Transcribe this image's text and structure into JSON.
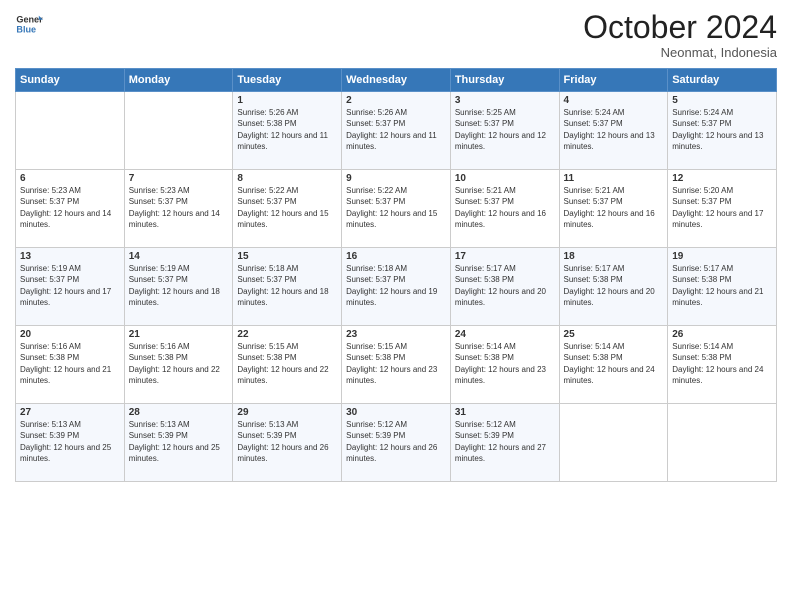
{
  "header": {
    "logo_line1": "General",
    "logo_line2": "Blue",
    "month": "October 2024",
    "location": "Neonmat, Indonesia"
  },
  "days_of_week": [
    "Sunday",
    "Monday",
    "Tuesday",
    "Wednesday",
    "Thursday",
    "Friday",
    "Saturday"
  ],
  "weeks": [
    [
      {
        "day": "",
        "sunrise": "",
        "sunset": "",
        "daylight": ""
      },
      {
        "day": "",
        "sunrise": "",
        "sunset": "",
        "daylight": ""
      },
      {
        "day": "1",
        "sunrise": "Sunrise: 5:26 AM",
        "sunset": "Sunset: 5:38 PM",
        "daylight": "Daylight: 12 hours and 11 minutes."
      },
      {
        "day": "2",
        "sunrise": "Sunrise: 5:26 AM",
        "sunset": "Sunset: 5:37 PM",
        "daylight": "Daylight: 12 hours and 11 minutes."
      },
      {
        "day": "3",
        "sunrise": "Sunrise: 5:25 AM",
        "sunset": "Sunset: 5:37 PM",
        "daylight": "Daylight: 12 hours and 12 minutes."
      },
      {
        "day": "4",
        "sunrise": "Sunrise: 5:24 AM",
        "sunset": "Sunset: 5:37 PM",
        "daylight": "Daylight: 12 hours and 13 minutes."
      },
      {
        "day": "5",
        "sunrise": "Sunrise: 5:24 AM",
        "sunset": "Sunset: 5:37 PM",
        "daylight": "Daylight: 12 hours and 13 minutes."
      }
    ],
    [
      {
        "day": "6",
        "sunrise": "Sunrise: 5:23 AM",
        "sunset": "Sunset: 5:37 PM",
        "daylight": "Daylight: 12 hours and 14 minutes."
      },
      {
        "day": "7",
        "sunrise": "Sunrise: 5:23 AM",
        "sunset": "Sunset: 5:37 PM",
        "daylight": "Daylight: 12 hours and 14 minutes."
      },
      {
        "day": "8",
        "sunrise": "Sunrise: 5:22 AM",
        "sunset": "Sunset: 5:37 PM",
        "daylight": "Daylight: 12 hours and 15 minutes."
      },
      {
        "day": "9",
        "sunrise": "Sunrise: 5:22 AM",
        "sunset": "Sunset: 5:37 PM",
        "daylight": "Daylight: 12 hours and 15 minutes."
      },
      {
        "day": "10",
        "sunrise": "Sunrise: 5:21 AM",
        "sunset": "Sunset: 5:37 PM",
        "daylight": "Daylight: 12 hours and 16 minutes."
      },
      {
        "day": "11",
        "sunrise": "Sunrise: 5:21 AM",
        "sunset": "Sunset: 5:37 PM",
        "daylight": "Daylight: 12 hours and 16 minutes."
      },
      {
        "day": "12",
        "sunrise": "Sunrise: 5:20 AM",
        "sunset": "Sunset: 5:37 PM",
        "daylight": "Daylight: 12 hours and 17 minutes."
      }
    ],
    [
      {
        "day": "13",
        "sunrise": "Sunrise: 5:19 AM",
        "sunset": "Sunset: 5:37 PM",
        "daylight": "Daylight: 12 hours and 17 minutes."
      },
      {
        "day": "14",
        "sunrise": "Sunrise: 5:19 AM",
        "sunset": "Sunset: 5:37 PM",
        "daylight": "Daylight: 12 hours and 18 minutes."
      },
      {
        "day": "15",
        "sunrise": "Sunrise: 5:18 AM",
        "sunset": "Sunset: 5:37 PM",
        "daylight": "Daylight: 12 hours and 18 minutes."
      },
      {
        "day": "16",
        "sunrise": "Sunrise: 5:18 AM",
        "sunset": "Sunset: 5:37 PM",
        "daylight": "Daylight: 12 hours and 19 minutes."
      },
      {
        "day": "17",
        "sunrise": "Sunrise: 5:17 AM",
        "sunset": "Sunset: 5:38 PM",
        "daylight": "Daylight: 12 hours and 20 minutes."
      },
      {
        "day": "18",
        "sunrise": "Sunrise: 5:17 AM",
        "sunset": "Sunset: 5:38 PM",
        "daylight": "Daylight: 12 hours and 20 minutes."
      },
      {
        "day": "19",
        "sunrise": "Sunrise: 5:17 AM",
        "sunset": "Sunset: 5:38 PM",
        "daylight": "Daylight: 12 hours and 21 minutes."
      }
    ],
    [
      {
        "day": "20",
        "sunrise": "Sunrise: 5:16 AM",
        "sunset": "Sunset: 5:38 PM",
        "daylight": "Daylight: 12 hours and 21 minutes."
      },
      {
        "day": "21",
        "sunrise": "Sunrise: 5:16 AM",
        "sunset": "Sunset: 5:38 PM",
        "daylight": "Daylight: 12 hours and 22 minutes."
      },
      {
        "day": "22",
        "sunrise": "Sunrise: 5:15 AM",
        "sunset": "Sunset: 5:38 PM",
        "daylight": "Daylight: 12 hours and 22 minutes."
      },
      {
        "day": "23",
        "sunrise": "Sunrise: 5:15 AM",
        "sunset": "Sunset: 5:38 PM",
        "daylight": "Daylight: 12 hours and 23 minutes."
      },
      {
        "day": "24",
        "sunrise": "Sunrise: 5:14 AM",
        "sunset": "Sunset: 5:38 PM",
        "daylight": "Daylight: 12 hours and 23 minutes."
      },
      {
        "day": "25",
        "sunrise": "Sunrise: 5:14 AM",
        "sunset": "Sunset: 5:38 PM",
        "daylight": "Daylight: 12 hours and 24 minutes."
      },
      {
        "day": "26",
        "sunrise": "Sunrise: 5:14 AM",
        "sunset": "Sunset: 5:38 PM",
        "daylight": "Daylight: 12 hours and 24 minutes."
      }
    ],
    [
      {
        "day": "27",
        "sunrise": "Sunrise: 5:13 AM",
        "sunset": "Sunset: 5:39 PM",
        "daylight": "Daylight: 12 hours and 25 minutes."
      },
      {
        "day": "28",
        "sunrise": "Sunrise: 5:13 AM",
        "sunset": "Sunset: 5:39 PM",
        "daylight": "Daylight: 12 hours and 25 minutes."
      },
      {
        "day": "29",
        "sunrise": "Sunrise: 5:13 AM",
        "sunset": "Sunset: 5:39 PM",
        "daylight": "Daylight: 12 hours and 26 minutes."
      },
      {
        "day": "30",
        "sunrise": "Sunrise: 5:12 AM",
        "sunset": "Sunset: 5:39 PM",
        "daylight": "Daylight: 12 hours and 26 minutes."
      },
      {
        "day": "31",
        "sunrise": "Sunrise: 5:12 AM",
        "sunset": "Sunset: 5:39 PM",
        "daylight": "Daylight: 12 hours and 27 minutes."
      },
      {
        "day": "",
        "sunrise": "",
        "sunset": "",
        "daylight": ""
      },
      {
        "day": "",
        "sunrise": "",
        "sunset": "",
        "daylight": ""
      }
    ]
  ]
}
